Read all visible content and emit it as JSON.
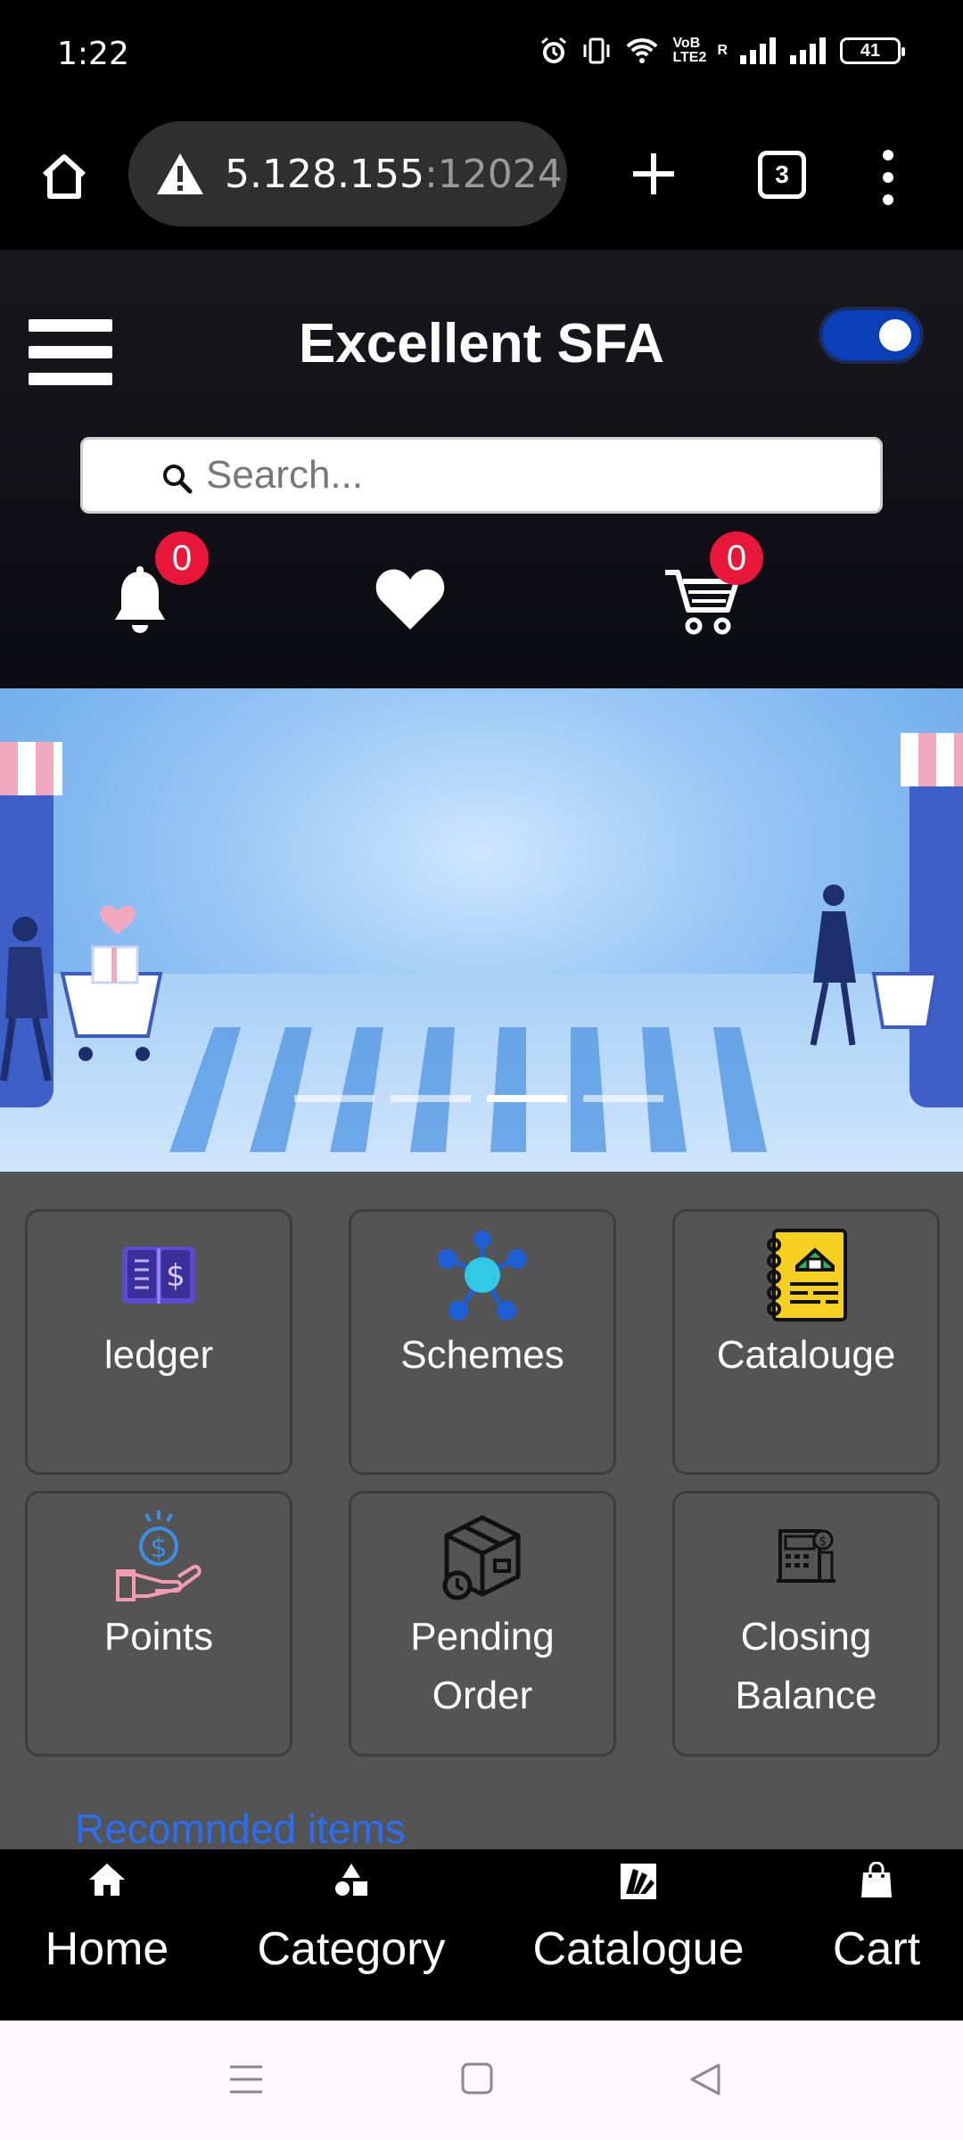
{
  "status_bar": {
    "time": "1:22",
    "network_label": "VoB LTE2",
    "signal_label": "R",
    "battery": "41"
  },
  "browser": {
    "url_host": "5.128.155",
    "url_port": ":12024",
    "tab_count": "3"
  },
  "header": {
    "title": "Excellent SFA",
    "search_placeholder": "Search...",
    "notification_count": "0",
    "cart_count": "0",
    "theme_toggle_on": true
  },
  "banner": {
    "slide_count": 4,
    "active_slide": 3
  },
  "tiles": [
    {
      "label": "ledger",
      "icon": "ledger-book-icon"
    },
    {
      "label": "Schemes",
      "icon": "schemes-network-icon"
    },
    {
      "label": "Catalouge",
      "icon": "catalogue-notebook-icon"
    },
    {
      "label": "Points",
      "icon": "points-hand-coin-icon"
    },
    {
      "label": "Pending Order",
      "icon": "pending-order-box-icon"
    },
    {
      "label": "Closing Balance",
      "icon": "closing-balance-register-icon"
    }
  ],
  "recommended_heading": "Recomnded items",
  "bottom_nav": [
    {
      "label": "Home",
      "icon": "home-icon"
    },
    {
      "label": "Category",
      "icon": "category-shapes-icon"
    },
    {
      "label": "Catalogue",
      "icon": "catalogue-icon"
    },
    {
      "label": "Cart",
      "icon": "shopping-bag-icon"
    }
  ],
  "colors": {
    "header_bg": "#18181c",
    "grid_bg": "#545454",
    "badge": "#e8173a",
    "link_blue": "#2a6ef5",
    "toggle": "#0a3fb8"
  }
}
